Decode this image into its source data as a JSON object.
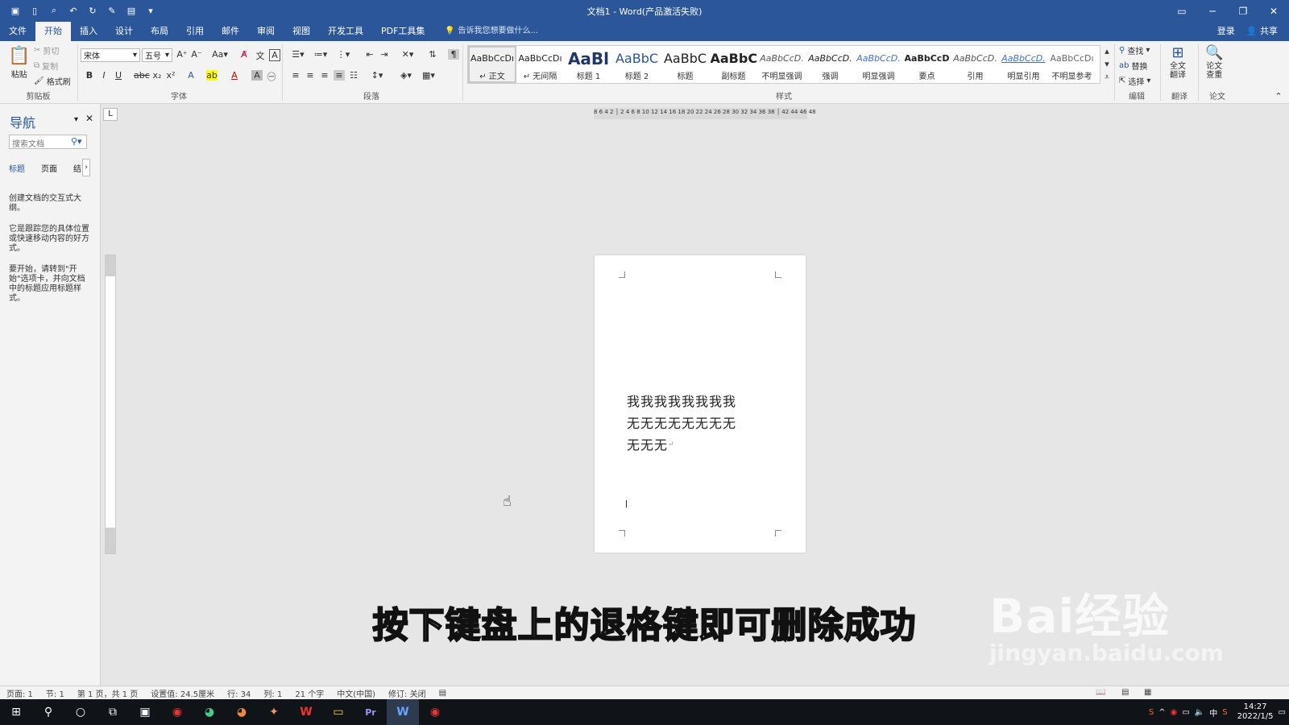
{
  "window": {
    "title": "文档1 - Word(产品激活失败)"
  },
  "ribbon_tabs": [
    "文件",
    "开始",
    "插入",
    "设计",
    "布局",
    "引用",
    "邮件",
    "审阅",
    "视图",
    "开发工具",
    "PDF工具集"
  ],
  "tell_me": "告诉我您想要做什么...",
  "account": {
    "login": "登录",
    "share": "共享"
  },
  "clipboard": {
    "paste": "粘贴",
    "cut": "剪切",
    "copy": "复制",
    "format_painter": "格式刷",
    "label": "剪贴板"
  },
  "font": {
    "name": "宋体",
    "size": "五号",
    "label": "字体"
  },
  "paragraph": {
    "label": "段落"
  },
  "styles": {
    "label": "样式",
    "items": [
      {
        "sample": "AaBbCcDı",
        "name": "↵ 正文"
      },
      {
        "sample": "AaBbCcDı",
        "name": "↵ 无间隔"
      },
      {
        "sample": "AaBl",
        "name": "标题 1"
      },
      {
        "sample": "AaBbC",
        "name": "标题 2"
      },
      {
        "sample": "AaBbC",
        "name": "标题"
      },
      {
        "sample": "AaBbC",
        "name": "副标题"
      },
      {
        "sample": "AaBbCcD.",
        "name": "不明显强调"
      },
      {
        "sample": "AaBbCcD.",
        "name": "强调"
      },
      {
        "sample": "AaBbCcD.",
        "name": "明显强调"
      },
      {
        "sample": "AaBbCcD",
        "name": "要点"
      },
      {
        "sample": "AaBbCcD.",
        "name": "引用"
      },
      {
        "sample": "AaBbCcD.",
        "name": "明显引用"
      },
      {
        "sample": "AaBbCcDı",
        "name": "不明显参考"
      }
    ]
  },
  "editing": {
    "find": "查找",
    "replace": "替换",
    "select": "选择",
    "label": "编辑"
  },
  "translate": {
    "full": "全文",
    "full2": "翻译",
    "label": "翻译"
  },
  "paper": {
    "check": "论文",
    "check2": "查重",
    "label": "论文"
  },
  "nav": {
    "title": "导航",
    "search_placeholder": "搜索文档",
    "tabs": [
      "标题",
      "页面",
      "结"
    ],
    "para1": "创建文档的交互式大纲。",
    "para2": "它是跟踪您的具体位置或快速移动内容的好方式。",
    "para3": "要开始，请转到\"开始\"选项卡，并向文档中的标题应用标题样式。"
  },
  "ruler": {
    "h_ticks": "8 6 4 2 │ 2 4 6 8 10 12 14 16 18 20 22 24 26 28 30 32 34 36 38 │ 42 44 46 48"
  },
  "document": {
    "line1": "我我我我我我我我",
    "line2": "无无无无无无无无",
    "line3": "无无无"
  },
  "status": {
    "page": "页面: 1",
    "section": "节: 1",
    "pages": "第 1 页，共 1 页",
    "position": "设置值: 24.5厘米",
    "row": "行: 34",
    "col": "列: 1",
    "words": "21 个字",
    "language": "中文(中国)",
    "track": "修订: 关闭"
  },
  "taskbar": {
    "time": "14:27",
    "date": "2022/1/5",
    "ime": "中"
  },
  "caption": "按下键盘上的退格键即可删除成功",
  "watermark": {
    "main": "Bai经验",
    "sub": "jingyan.baidu.com"
  },
  "colors": {
    "accent": "#2b579a"
  }
}
